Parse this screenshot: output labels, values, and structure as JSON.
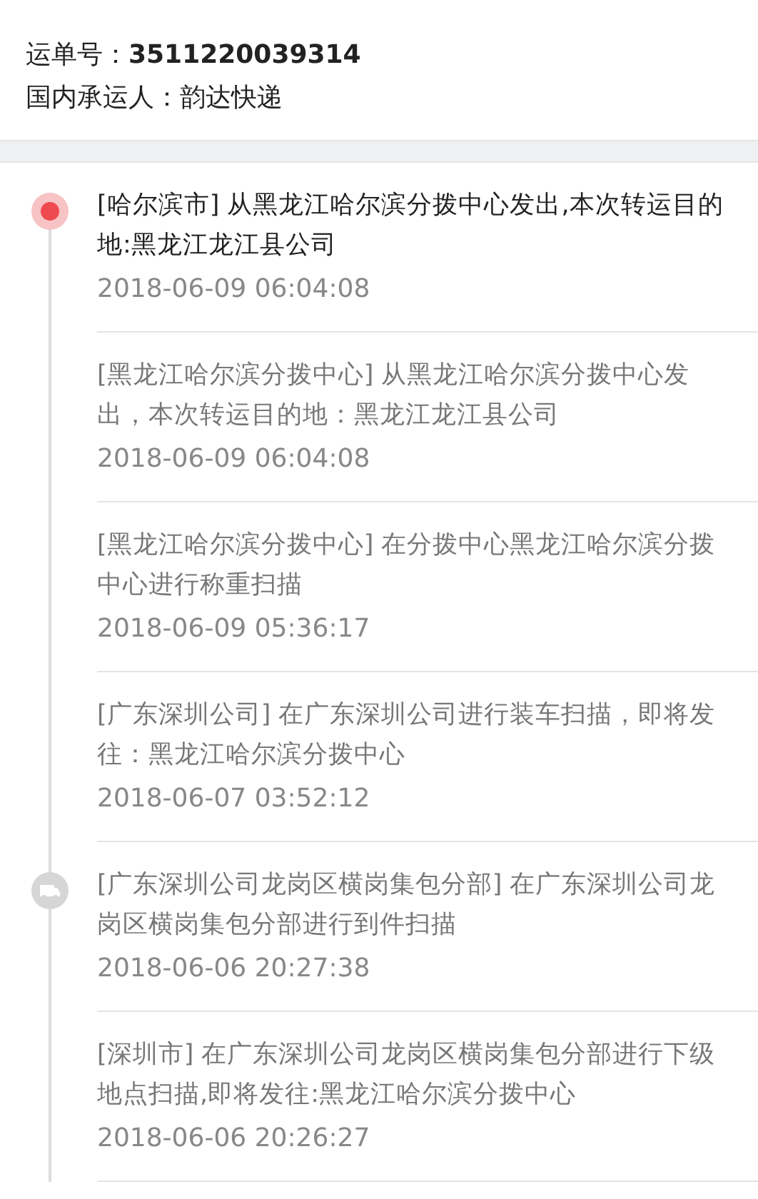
{
  "waybill": {
    "label": "运单号：",
    "number": "3511220039314"
  },
  "carrier": {
    "label": "国内承运人：",
    "name": "韵达快递"
  },
  "events": [
    {
      "kind": "current",
      "text": "[哈尔滨市] 从黑龙江哈尔滨分拨中心发出,本次转运目的地:黑龙江龙江县公司",
      "time": "2018-06-09 06:04:08"
    },
    {
      "kind": "plain",
      "text": "[黑龙江哈尔滨分拨中心] 从黑龙江哈尔滨分拨中心发出，本次转运目的地：黑龙江龙江县公司",
      "time": "2018-06-09 06:04:08"
    },
    {
      "kind": "plain",
      "text": "[黑龙江哈尔滨分拨中心] 在分拨中心黑龙江哈尔滨分拨中心进行称重扫描",
      "time": "2018-06-09 05:36:17"
    },
    {
      "kind": "plain",
      "text": "[广东深圳公司] 在广东深圳公司进行装车扫描，即将发往：黑龙江哈尔滨分拨中心",
      "time": "2018-06-07 03:52:12"
    },
    {
      "kind": "truck",
      "text": "[广东深圳公司龙岗区横岗集包分部] 在广东深圳公司龙岗区横岗集包分部进行到件扫描",
      "time": "2018-06-06 20:27:38"
    },
    {
      "kind": "plain",
      "text": "[深圳市] 在广东深圳公司龙岗区横岗集包分部进行下级地点扫描,即将发往:黑龙江哈尔滨分拨中心",
      "time": "2018-06-06 20:26:27"
    }
  ]
}
